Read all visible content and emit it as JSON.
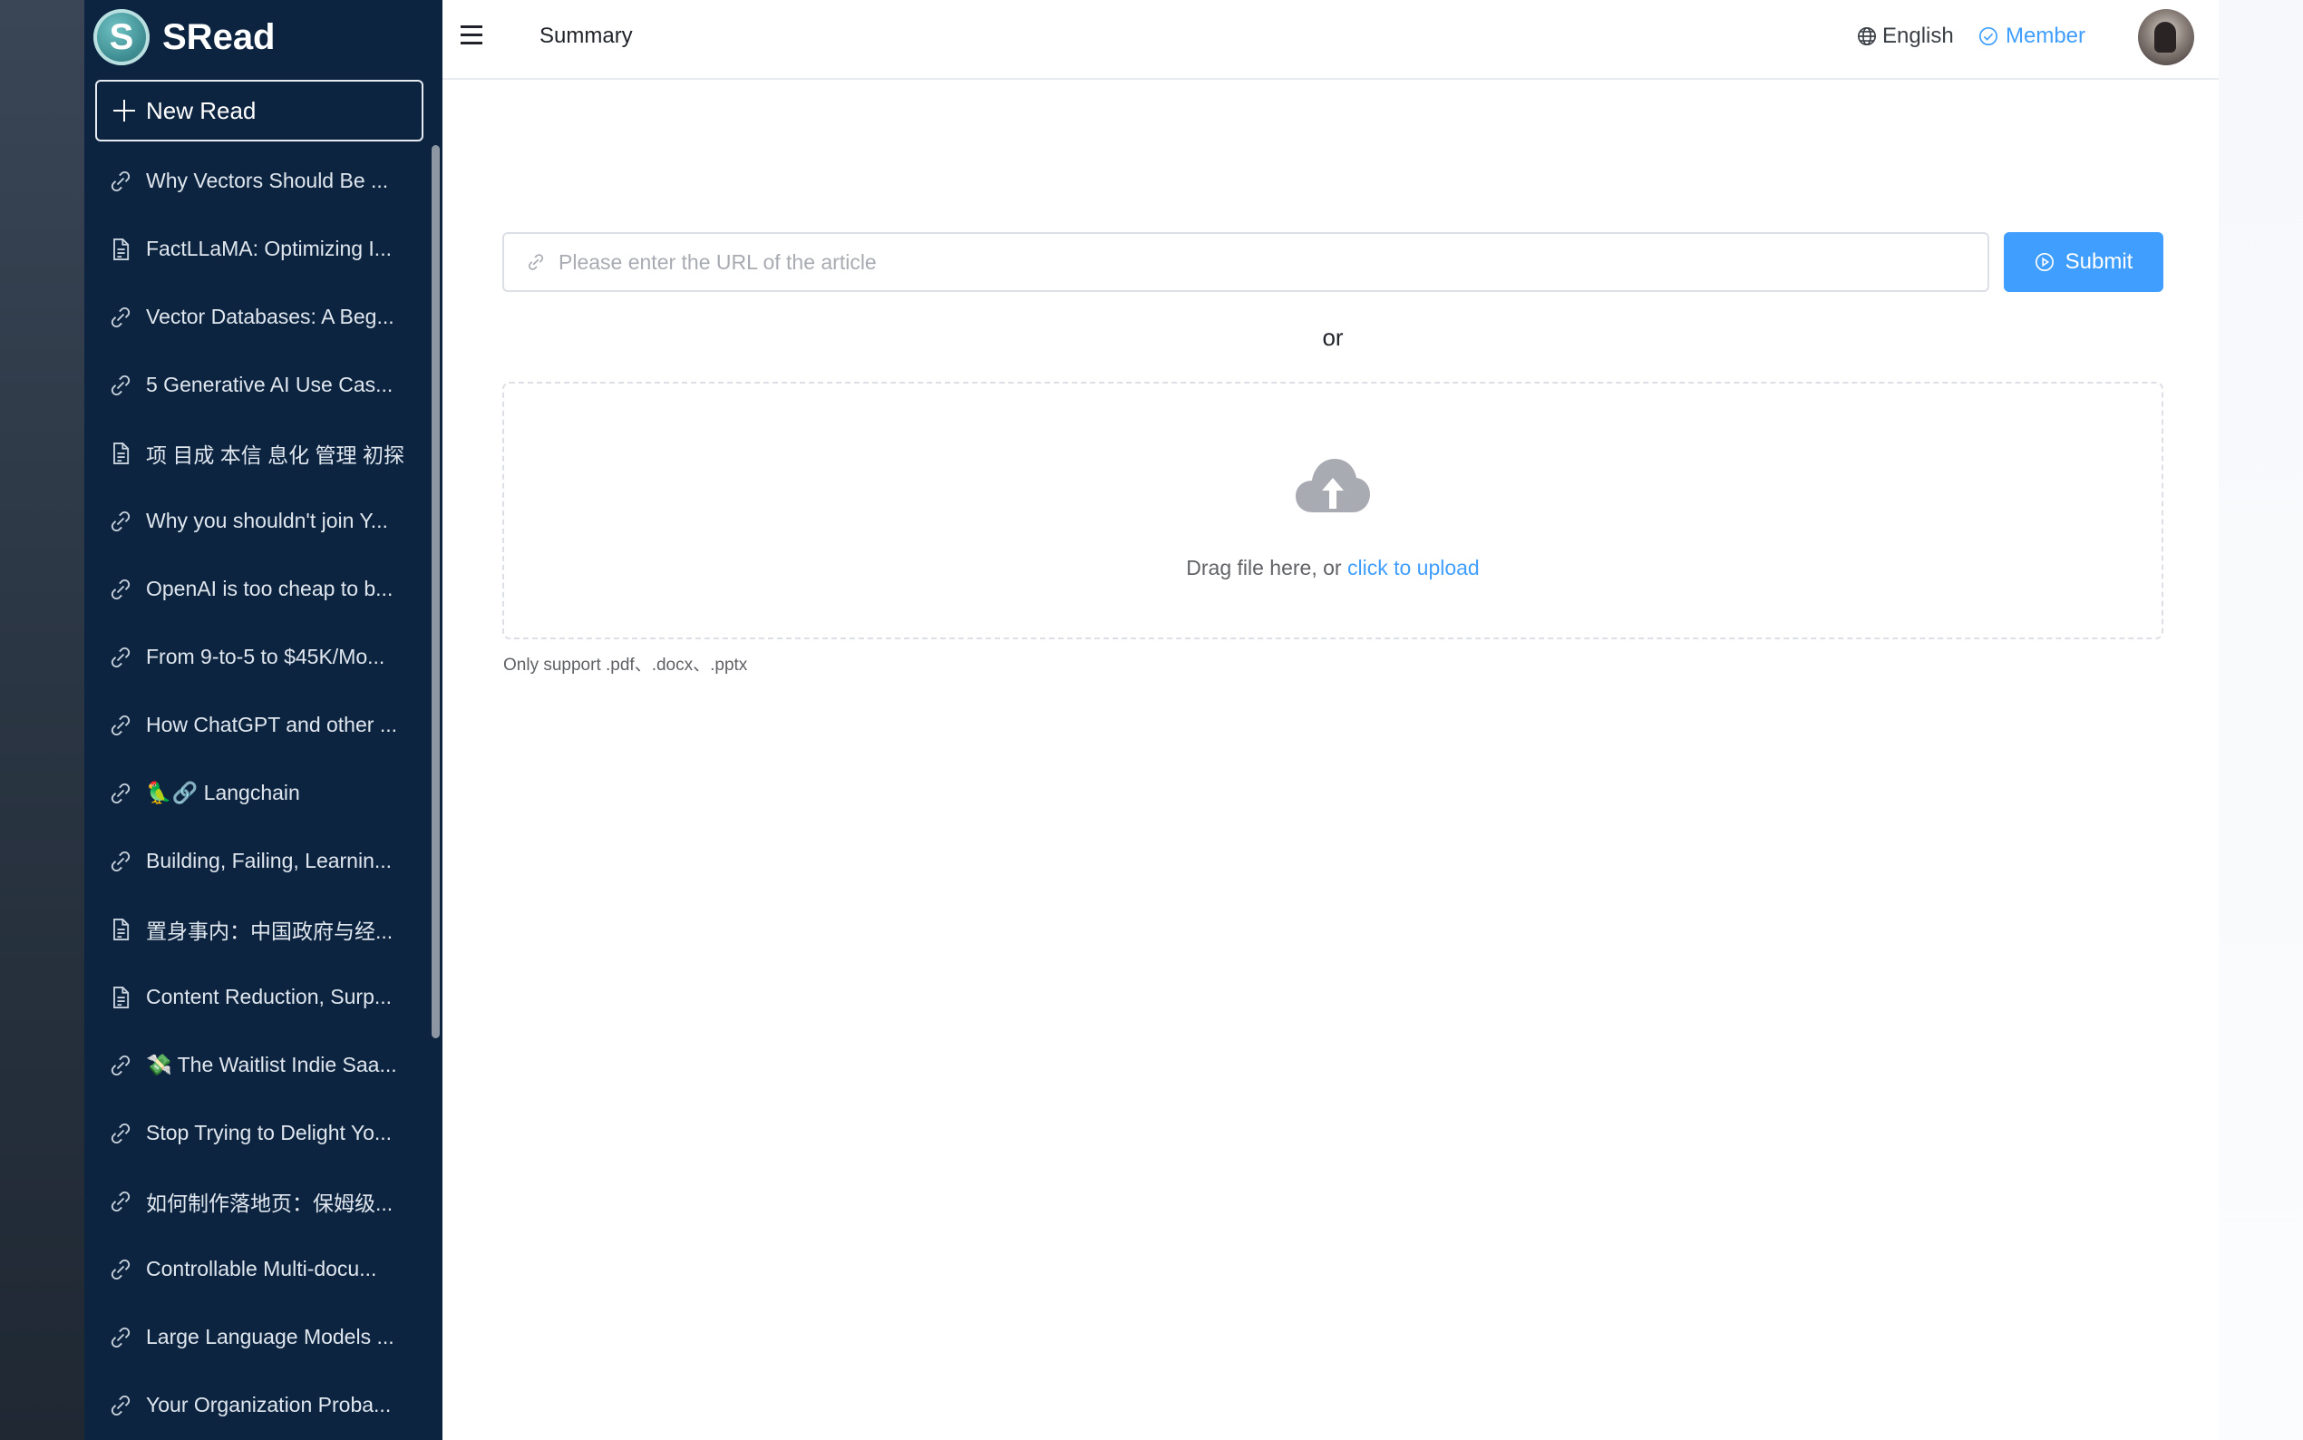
{
  "app": {
    "name": "SRead",
    "logo_letter": "S"
  },
  "sidebar": {
    "new_read_label": "New Read",
    "items": [
      {
        "icon": "link-icon",
        "label": "Why Vectors Should Be ..."
      },
      {
        "icon": "document-icon",
        "label": "FactLLaMA: Optimizing I..."
      },
      {
        "icon": "link-icon",
        "label": "Vector Databases: A Beg..."
      },
      {
        "icon": "link-icon",
        "label": "5 Generative AI Use Cas..."
      },
      {
        "icon": "document-icon",
        "label": "项 目成 本信 息化 管理 初探"
      },
      {
        "icon": "link-icon",
        "label": "Why you shouldn't join Y..."
      },
      {
        "icon": "link-icon",
        "label": "OpenAI is too cheap to b..."
      },
      {
        "icon": "link-icon",
        "label": "From 9-to-5 to $45K/Mo..."
      },
      {
        "icon": "link-icon",
        "label": "How ChatGPT and other ..."
      },
      {
        "icon": "link-icon",
        "label": "🦜🔗 Langchain"
      },
      {
        "icon": "link-icon",
        "label": "Building, Failing, Learnin..."
      },
      {
        "icon": "document-icon",
        "label": "置身事内：中国政府与经..."
      },
      {
        "icon": "document-icon",
        "label": "Content Reduction, Surp..."
      },
      {
        "icon": "link-icon",
        "label": "💸 The Waitlist Indie Saa..."
      },
      {
        "icon": "link-icon",
        "label": "Stop Trying to Delight Yo..."
      },
      {
        "icon": "link-icon",
        "label": "如何制作落地页：保姆级..."
      },
      {
        "icon": "link-icon",
        "label": "Controllable Multi-docu..."
      },
      {
        "icon": "link-icon",
        "label": "Large Language Models ..."
      },
      {
        "icon": "link-icon",
        "label": "Your Organization Proba..."
      }
    ]
  },
  "header": {
    "title": "Summary",
    "language": "English",
    "member": "Member"
  },
  "main": {
    "url_placeholder": "Please enter the URL of the article",
    "url_value": "",
    "submit_label": "Submit",
    "or_text": "or",
    "drop_text": "Drag file here, or ",
    "upload_link": "click to upload",
    "hint": "Only support .pdf、.docx、.pptx"
  },
  "colors": {
    "sidebar_bg": "#0c2440",
    "accent": "#409eff",
    "border": "#dcdfe6"
  }
}
